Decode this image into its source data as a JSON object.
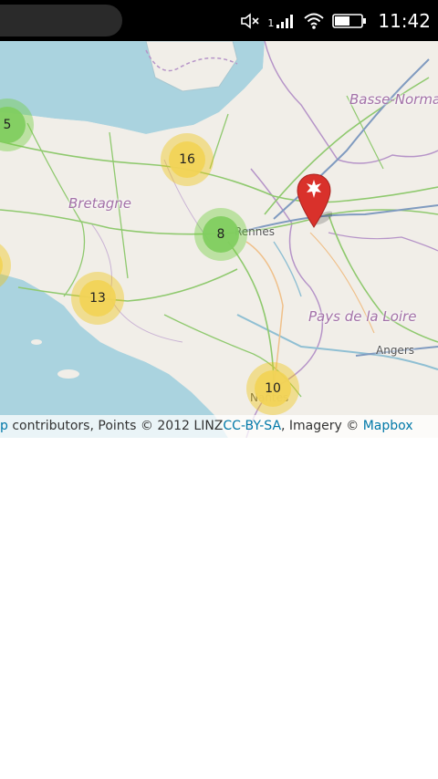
{
  "status_bar": {
    "time": "11:42",
    "signal_sim": "1",
    "icons": [
      "mute-icon",
      "signal-icon",
      "wifi-icon",
      "battery-icon"
    ]
  },
  "map": {
    "regions": [
      "Bretagne",
      "Basse-Norma",
      "Pays de la Loire"
    ],
    "cities": [
      "Rennes",
      "Angers",
      "Nantes"
    ],
    "clusters": [
      {
        "count": "5",
        "color": "green"
      },
      {
        "count": "16",
        "color": "yellow"
      },
      {
        "count": "8",
        "color": "green"
      },
      {
        "count": "13",
        "color": "yellow"
      },
      {
        "count": "10",
        "color": "yellow"
      }
    ],
    "marker_icon": "ermine-marker-icon",
    "colors": {
      "cluster_yellow": "#f1d357",
      "cluster_green": "#81ce60",
      "marker": "#d9312b",
      "sea": "#aad3df",
      "link": "#0078a8"
    }
  },
  "attribution": {
    "link_osm_tail": "p",
    "text_1": " contributors, Points © 2012 LINZ",
    "link_license": "CC-BY-SA",
    "text_2": ", Imagery © ",
    "link_imagery": "Mapbox"
  }
}
